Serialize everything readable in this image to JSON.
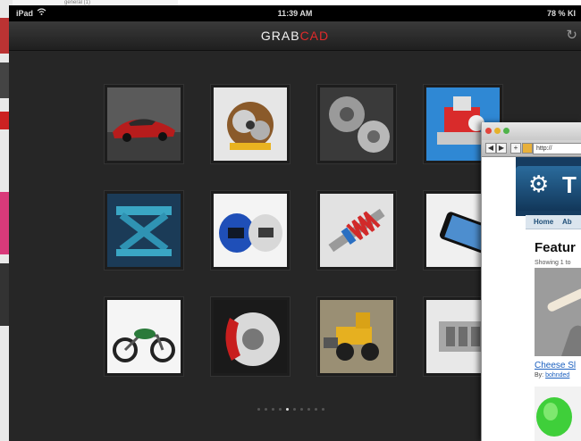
{
  "background_page": {
    "snippet": "general (1)"
  },
  "status_bar": {
    "device": "iPad",
    "time": "11:39 AM",
    "battery": "78 % KI"
  },
  "app": {
    "brand_left": "GRAB",
    "brand_right": "CAD",
    "refresh_icon": "refresh-icon"
  },
  "gallery": {
    "tiles": [
      {
        "name": "tile-red-sports-car",
        "subject": "red sports car"
      },
      {
        "name": "tile-gearbox",
        "subject": "gearbox cutaway"
      },
      {
        "name": "tile-bevel-gears",
        "subject": "bevel gears"
      },
      {
        "name": "tile-valve-assembly",
        "subject": "valve assembly"
      },
      {
        "name": "tile-scissor-lift",
        "subject": "scissor lift"
      },
      {
        "name": "tile-helmets",
        "subject": "helmets"
      },
      {
        "name": "tile-shock-absorber",
        "subject": "shock absorber"
      },
      {
        "name": "tile-smartphone",
        "subject": "smartphone"
      },
      {
        "name": "tile-motorcycle",
        "subject": "motorcycle"
      },
      {
        "name": "tile-brake-disc",
        "subject": "brake disc"
      },
      {
        "name": "tile-wheel-loader",
        "subject": "wheel loader"
      },
      {
        "name": "tile-engine",
        "subject": "engine"
      }
    ],
    "page_count": 10,
    "active_page": 4
  },
  "browser": {
    "url": "http://",
    "nav": {
      "home": "Home",
      "about": "Ab"
    },
    "heading": "Featur",
    "showing": "Showing 1 to",
    "item_title": "Cheese Sl",
    "by_label": "By:",
    "author": "bohnded",
    "site_letter": "T"
  },
  "colors": {
    "brand_accent": "#e02a2a",
    "ipad_bg": "#262626",
    "site_header": "#163c60",
    "link": "#1a5fbf"
  }
}
